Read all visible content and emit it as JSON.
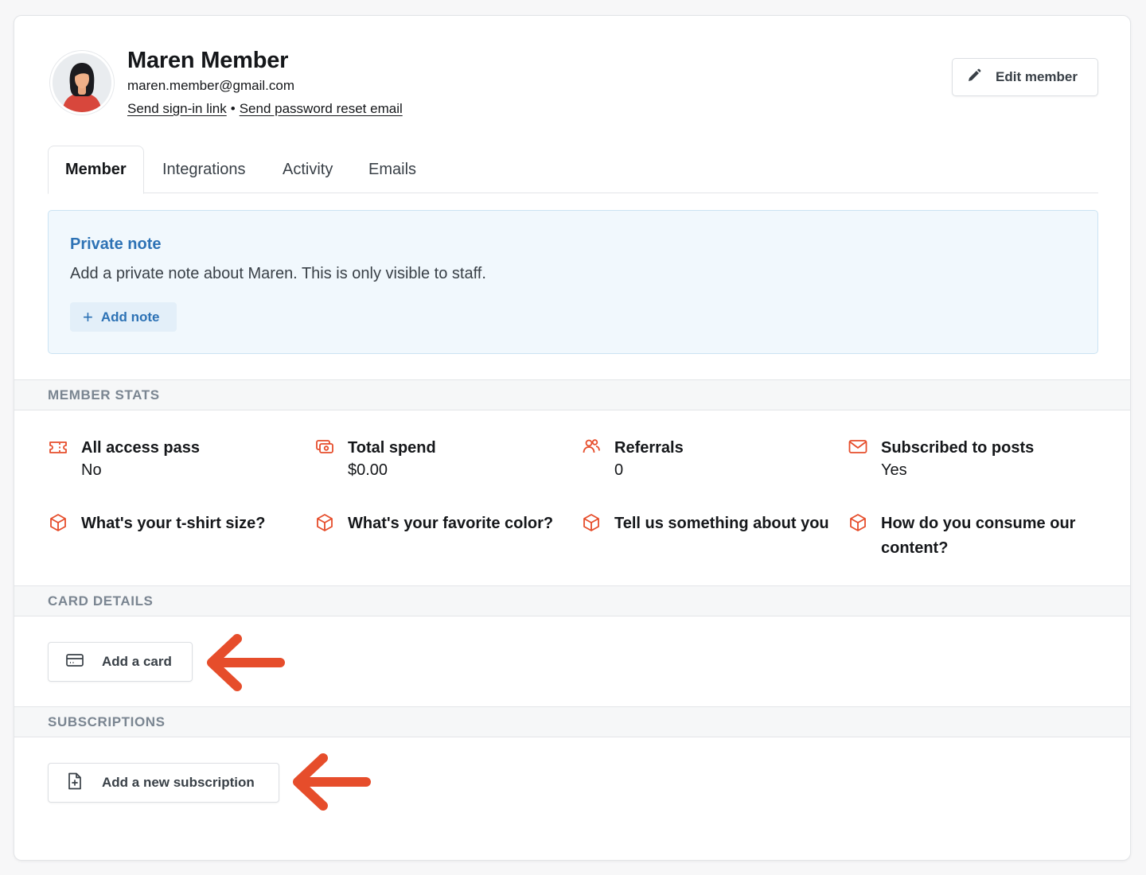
{
  "member": {
    "name": "Maren Member",
    "email": "maren.member@gmail.com",
    "signin_link": "Send sign-in link",
    "separator": "•",
    "reset_link": "Send password reset email",
    "edit_label": "Edit member"
  },
  "tabs": [
    {
      "label": "Member",
      "active": true
    },
    {
      "label": "Integrations",
      "active": false
    },
    {
      "label": "Activity",
      "active": false
    },
    {
      "label": "Emails",
      "active": false
    }
  ],
  "note": {
    "title": "Private note",
    "description": "Add a private note about Maren. This is only visible to staff.",
    "button_label": "Add note",
    "button_icon": "plus-icon"
  },
  "member_stats": {
    "heading": "MEMBER STATS",
    "items": [
      {
        "icon": "ticket-icon",
        "label": "All access pass",
        "value": "No"
      },
      {
        "icon": "wallet-icon",
        "label": "Total spend",
        "value": "$0.00"
      },
      {
        "icon": "users-icon",
        "label": "Referrals",
        "value": "0"
      },
      {
        "icon": "envelope-icon",
        "label": "Subscribed to posts",
        "value": "Yes"
      },
      {
        "icon": "cube-icon",
        "label": "What's your t-shirt size?",
        "value": ""
      },
      {
        "icon": "cube-icon",
        "label": "What's your favorite color?",
        "value": ""
      },
      {
        "icon": "cube-icon",
        "label": "Tell us something about you",
        "value": ""
      },
      {
        "icon": "cube-icon",
        "label": "How do you consume our content?",
        "value": ""
      }
    ]
  },
  "card_details": {
    "heading": "CARD DETAILS",
    "button_label": "Add a card",
    "button_icon": "credit-card-icon"
  },
  "subscriptions": {
    "heading": "SUBSCRIPTIONS",
    "button_label": "Add a new subscription",
    "button_icon": "file-plus-icon"
  },
  "colors": {
    "accent": "#e64d2b",
    "note_blue": "#2d72b5",
    "note_bg": "#f1f8fd"
  }
}
